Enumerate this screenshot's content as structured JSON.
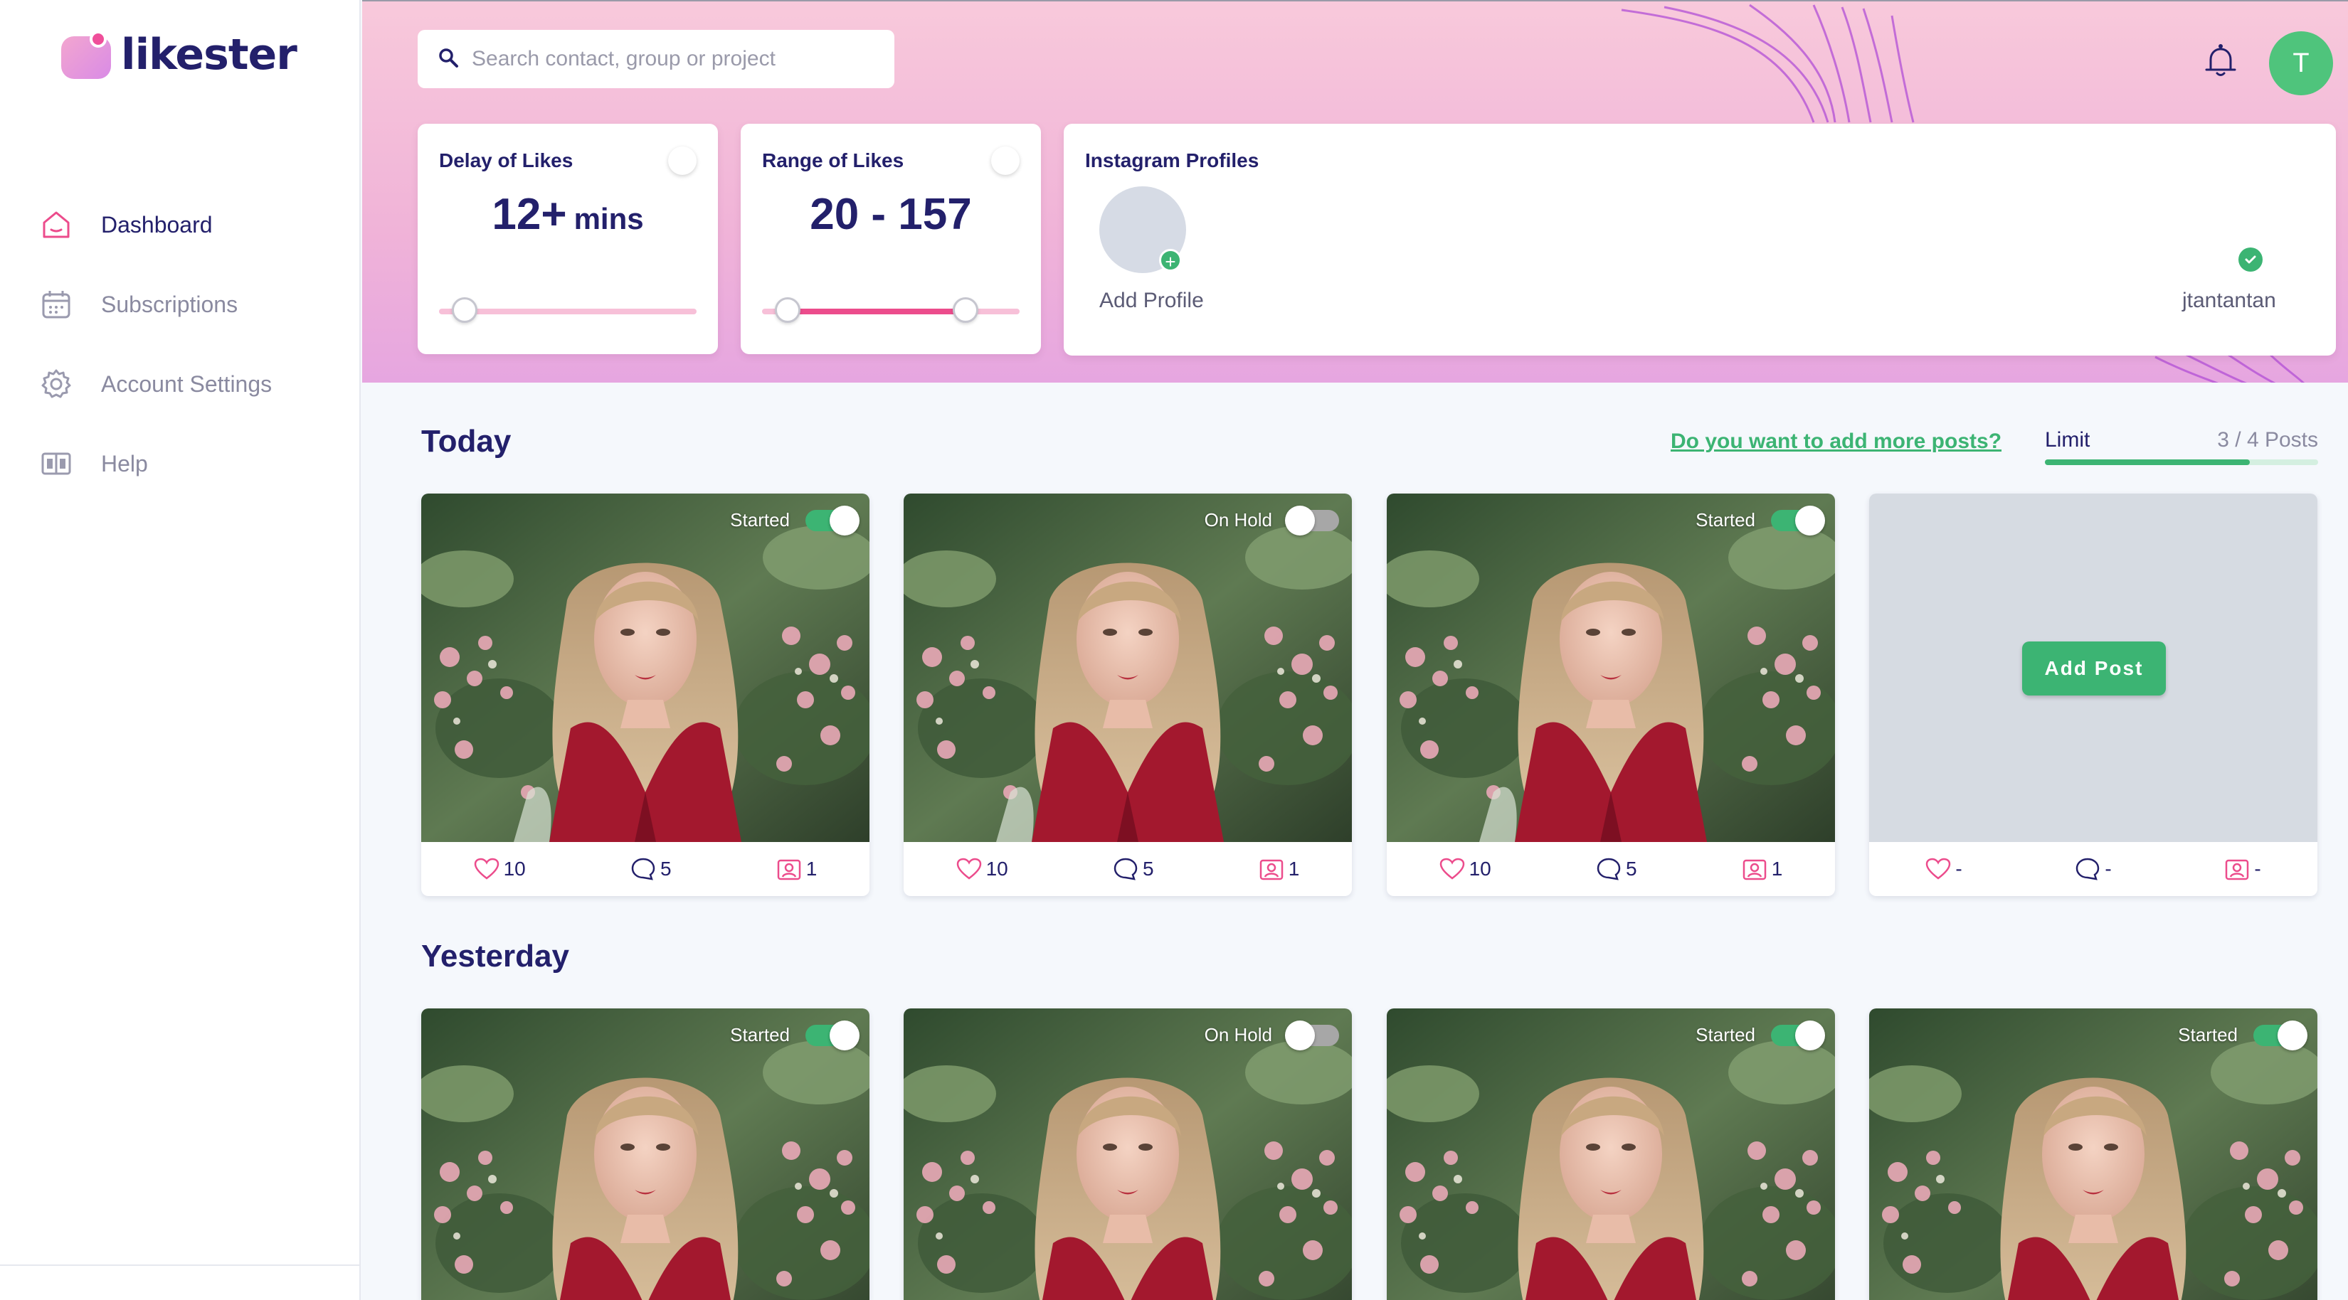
{
  "app": {
    "name": "likester"
  },
  "sidebar": {
    "items": [
      {
        "label": "Dashboard",
        "icon": "home-icon",
        "active": true
      },
      {
        "label": "Subscriptions",
        "icon": "calendar-icon",
        "active": false
      },
      {
        "label": "Account Settings",
        "icon": "gear-icon",
        "active": false
      },
      {
        "label": "Help",
        "icon": "book-icon",
        "active": false
      }
    ]
  },
  "header": {
    "search_placeholder": "Search contact, group or project",
    "avatar_initial": "T"
  },
  "delay_card": {
    "title": "Delay of Likes",
    "value": "12+",
    "unit": "mins",
    "slider_level": 0.1
  },
  "range_card": {
    "title": "Range of Likes",
    "value": "20 - 157",
    "slider_low": 0.1,
    "slider_high": 0.79
  },
  "profiles_card": {
    "title": "Instagram Profiles",
    "add_label": "Add Profile",
    "profile_name": "jtantantan"
  },
  "today": {
    "title": "Today",
    "more_link": "Do you want to add more posts?",
    "limit_label": "Limit",
    "limit_value": "3 / 4 Posts",
    "limit_fraction": 0.75,
    "posts": [
      {
        "status": "Started",
        "likes": "10",
        "comments": "5",
        "tags": "1"
      },
      {
        "status": "On Hold",
        "likes": "10",
        "comments": "5",
        "tags": "1"
      },
      {
        "status": "Started",
        "likes": "10",
        "comments": "5",
        "tags": "1"
      }
    ],
    "add_post": {
      "button": "Add Post",
      "likes": "-",
      "comments": "-",
      "tags": "-"
    }
  },
  "yesterday": {
    "title": "Yesterday",
    "posts": [
      {
        "status": "Started"
      },
      {
        "status": "On Hold"
      },
      {
        "status": "Started"
      },
      {
        "status": "Started"
      }
    ]
  },
  "colors": {
    "brand": "#23206b",
    "accent_green": "#3cb473",
    "accent_pink": "#ec4c8c"
  }
}
